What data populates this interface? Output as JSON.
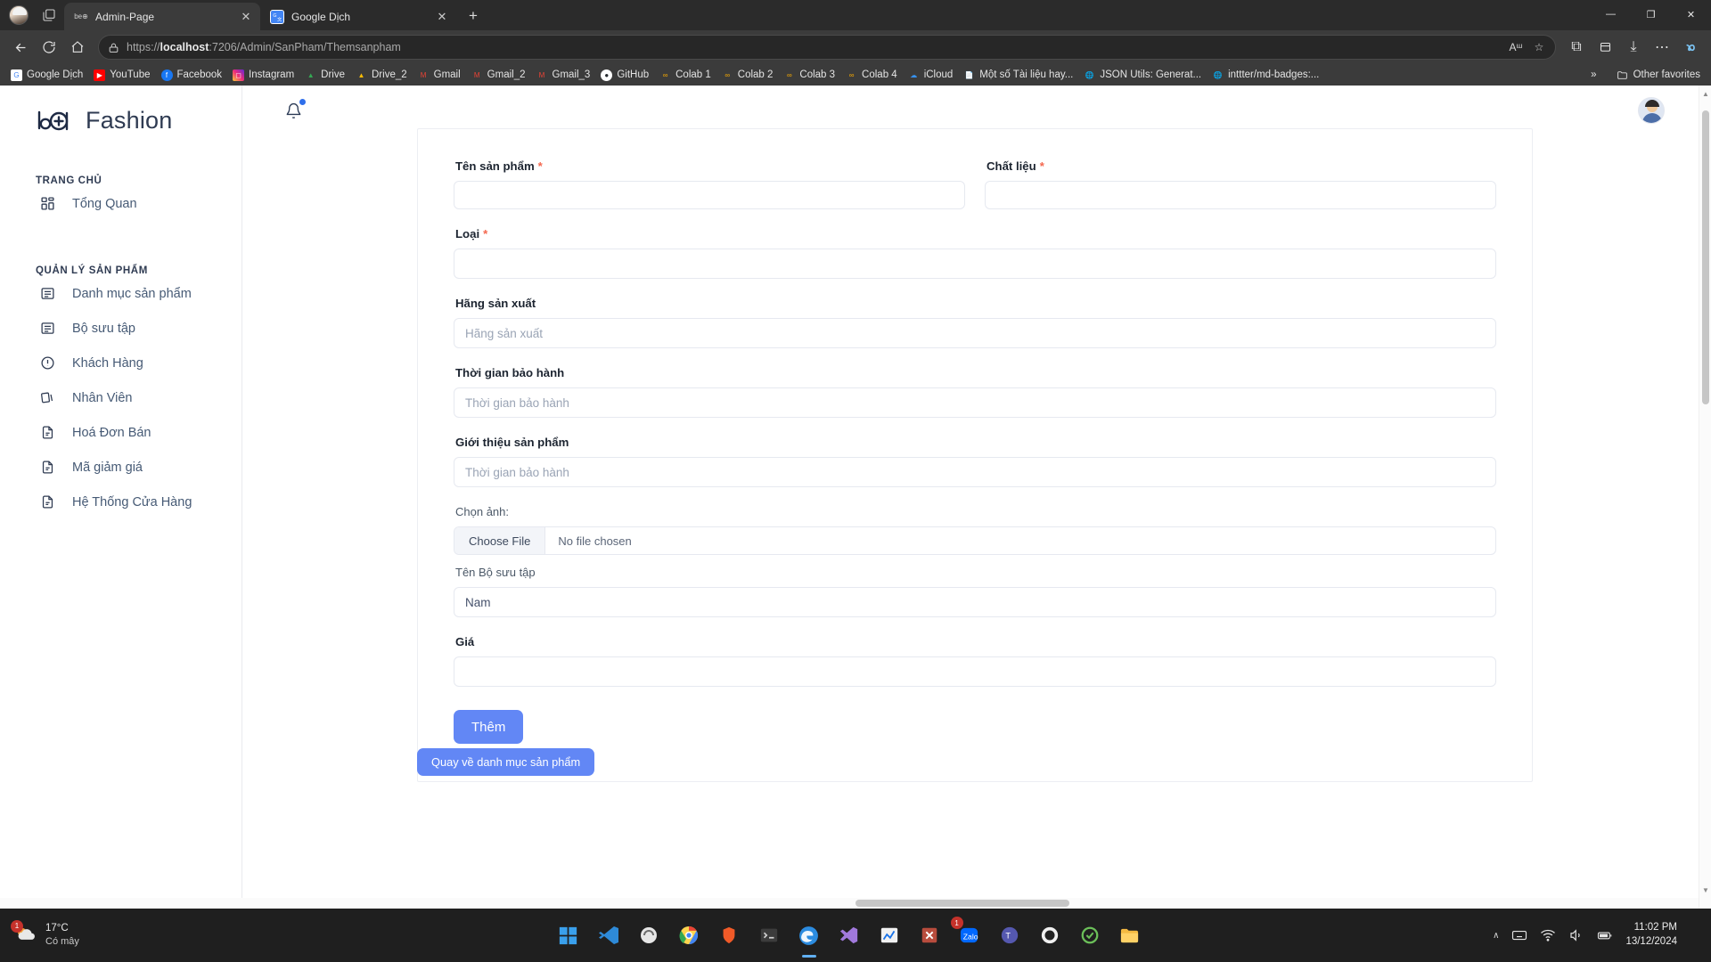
{
  "browser": {
    "tabs": [
      {
        "title": "Admin-Page",
        "favicon_name": "be-fashion-favicon",
        "active": true,
        "close_label": "✕"
      },
      {
        "title": "Google Dịch",
        "favicon_name": "google-translate-favicon",
        "active": false,
        "close_label": "✕"
      }
    ],
    "new_tab_label": "+",
    "window_controls": {
      "minimize": "—",
      "maximize": "❐",
      "close": "✕"
    },
    "nav": {
      "back": "←",
      "reload": "↻",
      "home": "⌂"
    },
    "omnibox": {
      "lock_icon": "lock-icon",
      "url_prefix": "https://",
      "url_host": "localhost",
      "url_rest": ":7206/Admin/SanPham/Themsanpham",
      "read_aloud": "Aᵚ",
      "favorite": "☆",
      "split": "⧉",
      "collections": "⬚",
      "downloads": "⤓",
      "settings": "⋯",
      "copilot": "copilot-icon"
    },
    "bookmarks": [
      {
        "label": "Google Dịch",
        "icon": "google-translate-icon",
        "color": "#4285f4"
      },
      {
        "label": "YouTube",
        "icon": "youtube-icon",
        "color": "#ff0000"
      },
      {
        "label": "Facebook",
        "icon": "facebook-icon",
        "color": "#1877f2"
      },
      {
        "label": "Instagram",
        "icon": "instagram-icon",
        "color": "#e1306c"
      },
      {
        "label": "Drive",
        "icon": "google-drive-icon",
        "color": "#34a853"
      },
      {
        "label": "Drive_2",
        "icon": "google-drive-icon",
        "color": "#fbbc05"
      },
      {
        "label": "Gmail",
        "icon": "gmail-icon",
        "color": "#ea4335"
      },
      {
        "label": "Gmail_2",
        "icon": "gmail-icon",
        "color": "#ea4335"
      },
      {
        "label": "Gmail_3",
        "icon": "gmail-icon",
        "color": "#ea4335"
      },
      {
        "label": "GitHub",
        "icon": "github-icon",
        "color": "#24292e"
      },
      {
        "label": "Colab 1",
        "icon": "colab-icon",
        "color": "#f9ab00"
      },
      {
        "label": "Colab 2",
        "icon": "colab-icon",
        "color": "#f9ab00"
      },
      {
        "label": "Colab 3",
        "icon": "colab-icon",
        "color": "#f9ab00"
      },
      {
        "label": "Colab 4",
        "icon": "colab-icon",
        "color": "#f9ab00"
      },
      {
        "label": "iCloud",
        "icon": "icloud-icon",
        "color": "#3693f3"
      },
      {
        "label": "Một số Tài liệu hay...",
        "icon": "google-docs-icon",
        "color": "#4285f4"
      },
      {
        "label": "JSON Utils: Generat...",
        "icon": "globe-icon",
        "color": "#7a7a7a"
      },
      {
        "label": "inttter/md-badges:...",
        "icon": "globe-icon",
        "color": "#7a7a7a"
      }
    ],
    "bookmarks_overflow_label": "»",
    "other_favorites_label": "Other favorites"
  },
  "app": {
    "brand": {
      "mark": "be-plus-logo",
      "name": "Fashion"
    },
    "sidebar": {
      "sections": [
        {
          "title": "TRANG CHỦ",
          "items": [
            {
              "label": "Tổng Quan",
              "icon": "dashboard-grid-icon"
            }
          ]
        },
        {
          "title": "QUẢN LÝ SẢN PHẨM",
          "items": [
            {
              "label": "Danh mục sản phẩm",
              "icon": "list-icon"
            },
            {
              "label": "Bộ sưu tập",
              "icon": "list-icon"
            },
            {
              "label": "Khách Hàng",
              "icon": "alert-circle-icon"
            },
            {
              "label": "Nhân Viên",
              "icon": "cards-icon"
            },
            {
              "label": "Hoá Đơn Bán",
              "icon": "document-icon"
            },
            {
              "label": "Mã giảm giá",
              "icon": "document-icon"
            },
            {
              "label": "Hệ Thống Cửa Hàng",
              "icon": "document-icon"
            }
          ]
        }
      ]
    },
    "topbar": {
      "bell_icon": "bell-icon",
      "avatar": "user-avatar"
    },
    "form": {
      "fields": {
        "ten_san_pham": {
          "label": "Tên sản phẩm",
          "required": "*",
          "value": "",
          "placeholder": ""
        },
        "chat_lieu": {
          "label": "Chất liệu",
          "required": "*",
          "value": "",
          "placeholder": ""
        },
        "loai": {
          "label": "Loại",
          "required": "*",
          "value": "",
          "placeholder": ""
        },
        "hang_san_xuat": {
          "label": "Hãng sản xuất",
          "required": "",
          "value": "",
          "placeholder": "Hãng sản xuất"
        },
        "thoi_gian_bao_hanh": {
          "label": "Thời gian bảo hành",
          "required": "",
          "value": "",
          "placeholder": "Thời gian bảo hành"
        },
        "gioi_thieu": {
          "label": "Giới thiệu sản phẩm",
          "required": "",
          "value": "",
          "placeholder": "Thời gian bảo hành"
        },
        "chon_anh": {
          "label": "Chọn ảnh:",
          "choose_button": "Choose File",
          "file_status": "No file chosen"
        },
        "bo_suu_tap": {
          "label": "Tên Bộ sưu tập",
          "value": "Nam",
          "options": [
            "Nam"
          ]
        },
        "gia": {
          "label": "Giá",
          "required": "",
          "value": "",
          "placeholder": ""
        }
      },
      "submit_label": "Thêm",
      "back_label": "Quay về danh mục sản phẩm"
    },
    "accent_color": "#6287f5",
    "required_color": "#f4684f"
  },
  "taskbar": {
    "weather": {
      "temperature": "17°C",
      "condition": "Có mây",
      "badge": "1",
      "icon": "cloud-sun-icon"
    },
    "apps": [
      {
        "name": "start-button",
        "icon": "windows-logo"
      },
      {
        "name": "vscode",
        "icon": "vscode-icon"
      },
      {
        "name": "sql-server-management-studio",
        "icon": "ssms-icon"
      },
      {
        "name": "chrome",
        "icon": "chrome-icon"
      },
      {
        "name": "brave",
        "icon": "brave-icon"
      },
      {
        "name": "terminal",
        "icon": "terminal-icon"
      },
      {
        "name": "edge",
        "icon": "edge-icon"
      },
      {
        "name": "visual-studio",
        "icon": "visual-studio-icon"
      },
      {
        "name": "chart-app",
        "icon": "chart-icon"
      },
      {
        "name": "excel",
        "icon": "excel-icon"
      },
      {
        "name": "zalo",
        "icon": "zalo-icon",
        "badge": "1"
      },
      {
        "name": "teams",
        "icon": "teams-icon"
      },
      {
        "name": "github-desktop",
        "icon": "github-icon"
      },
      {
        "name": "security-app",
        "icon": "shield-icon"
      },
      {
        "name": "file-explorer",
        "icon": "folder-icon"
      }
    ],
    "tray": {
      "chevron": "∧",
      "keyboard": "keyboard-icon",
      "wifi": "wifi-icon",
      "volume": "volume-icon",
      "battery": "battery-icon",
      "time": "11:02 PM",
      "date": "13/12/2024",
      "notification": "notification-pill"
    }
  }
}
